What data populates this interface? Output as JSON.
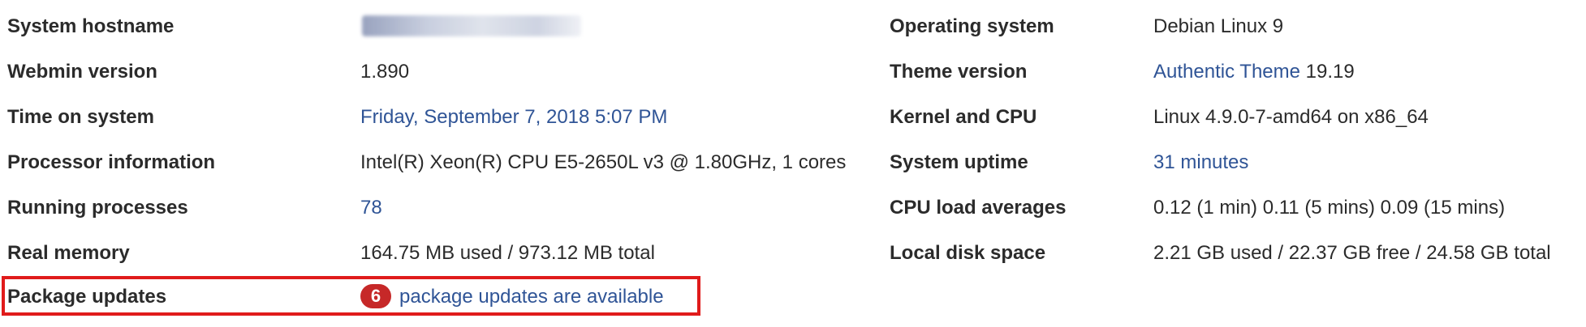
{
  "left": {
    "hostname_label": "System hostname",
    "webmin_label": "Webmin version",
    "webmin_value": "1.890",
    "time_label": "Time on system",
    "time_value": "Friday, September 7, 2018 5:07 PM",
    "processor_label": "Processor information",
    "processor_value": "Intel(R) Xeon(R) CPU E5-2650L v3 @ 1.80GHz, 1 cores",
    "processes_label": "Running processes",
    "processes_value": "78",
    "memory_label": "Real memory",
    "memory_value": "164.75 MB used / 973.12 MB total",
    "updates_label": "Package updates",
    "updates_count": "6",
    "updates_text": "package updates are available"
  },
  "right": {
    "os_label": "Operating system",
    "os_value": "Debian Linux 9",
    "theme_label": "Theme version",
    "theme_link": "Authentic Theme",
    "theme_version": "19.19",
    "kernel_label": "Kernel and CPU",
    "kernel_value": "Linux 4.9.0-7-amd64 on x86_64",
    "uptime_label": "System uptime",
    "uptime_value": "31 minutes",
    "load_label": "CPU load averages",
    "load_value": "0.12 (1 min) 0.11 (5 mins) 0.09 (15 mins)",
    "disk_label": "Local disk space",
    "disk_value": "2.21 GB used / 22.37 GB free / 24.58 GB total"
  },
  "colors": {
    "link": "#2f5496",
    "highlight": "#e01b1b",
    "badge": "#c62828"
  }
}
